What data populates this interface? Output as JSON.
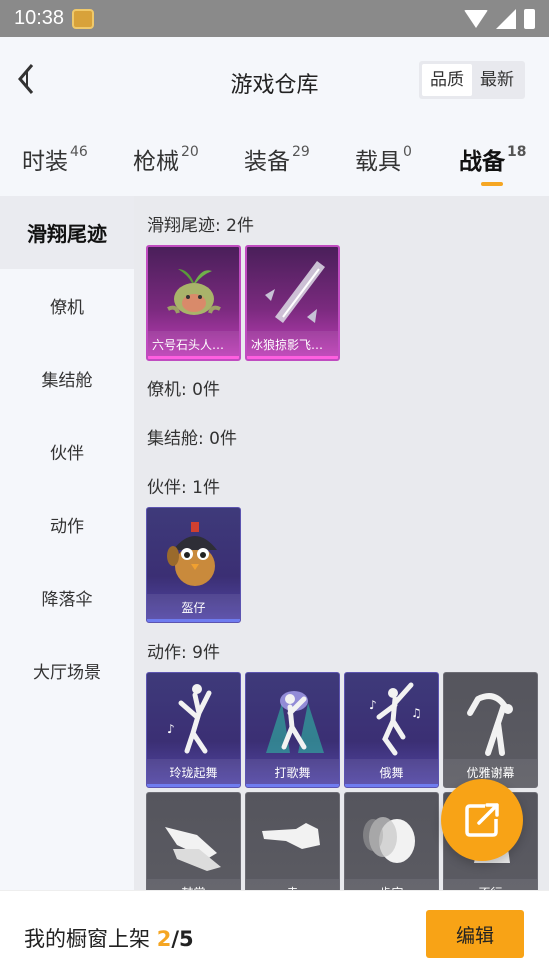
{
  "status": {
    "time": "10:38"
  },
  "header": {
    "title": "游戏仓库",
    "sort": [
      "品质",
      "最新"
    ]
  },
  "tabs": [
    {
      "label": "时装",
      "count": "46"
    },
    {
      "label": "枪械",
      "count": "20"
    },
    {
      "label": "装备",
      "count": "29"
    },
    {
      "label": "载具",
      "count": "0"
    },
    {
      "label": "战备",
      "count": "18"
    }
  ],
  "sidebar": [
    "滑翔尾迹",
    "僚机",
    "集结舱",
    "伙伴",
    "动作",
    "降落伞",
    "大厅场景"
  ],
  "sections": {
    "trail": {
      "title": "滑翔尾迹: 2件",
      "items": [
        "六号石头人飞…",
        "冰狼掠影飞行…"
      ]
    },
    "wingman": {
      "title": "僚机: 0件"
    },
    "pod": {
      "title": "集结舱: 0件"
    },
    "partner": {
      "title": "伙伴: 1件",
      "items": [
        "盔仔"
      ]
    },
    "emote": {
      "title": "动作: 9件",
      "items": [
        "玲珑起舞",
        "打歌舞",
        "俄舞",
        "优雅谢幕",
        "鼓掌",
        "走",
        "肯定",
        "不行"
      ]
    }
  },
  "bottom": {
    "prefix": "我的橱窗上架 ",
    "count": "2",
    "total": "/5",
    "edit": "编辑"
  },
  "colors": {
    "accent": "#f8a316"
  }
}
